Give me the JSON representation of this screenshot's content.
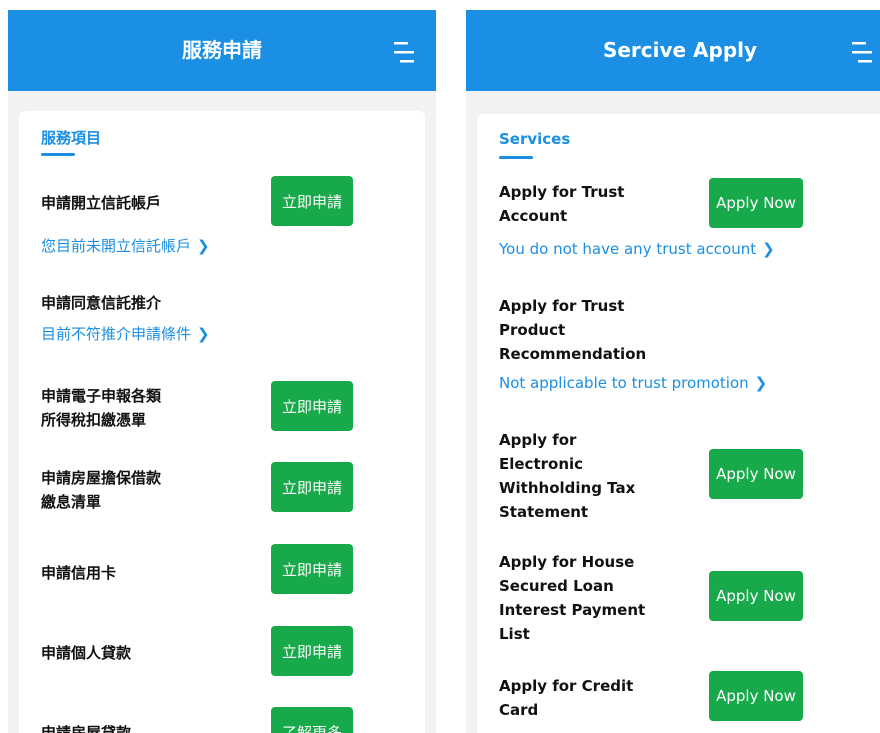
{
  "zh": {
    "header_title": "服務申請",
    "section_title": "服務項目",
    "items": [
      {
        "label": "申請開立信託帳戶",
        "button": "立即申請",
        "link": "您目前未開立信託帳戶"
      },
      {
        "label": "申請同意信託推介",
        "link": "目前不符推介申請條件"
      },
      {
        "label": "申請電子申報各類\n所得稅扣繳憑單",
        "button": "立即申請"
      },
      {
        "label": "申請房屋擔保借款\n繳息清單",
        "button": "立即申請"
      },
      {
        "label": "申請信用卡",
        "button": "立即申請"
      },
      {
        "label": "申請個人貸款",
        "button": "立即申請"
      },
      {
        "label": "申請房屋貸款",
        "button": "了解更多"
      }
    ]
  },
  "en": {
    "header_title": "Sercive Apply",
    "section_title": "Services",
    "items": [
      {
        "label": "Apply for Trust\nAccount",
        "button": "Apply Now",
        "link": "You do not have any trust account"
      },
      {
        "label": "Apply for Trust\nProduct\nRecommendation",
        "link": "Not applicable to trust promotion"
      },
      {
        "label": "Apply for\nElectronic\nWithholding Tax\nStatement",
        "button": "Apply Now"
      },
      {
        "label": "Apply for House\nSecured Loan\nInterest Payment\nList",
        "button": "Apply Now"
      },
      {
        "label": "Apply for Credit\nCard",
        "button": "Apply Now"
      }
    ]
  },
  "icons": {
    "menu": "menu-icon",
    "chevron": "chevron-right-icon"
  },
  "colors": {
    "header": "#1a8fe3",
    "button": "#17a94a",
    "link": "#1a8fe3"
  }
}
